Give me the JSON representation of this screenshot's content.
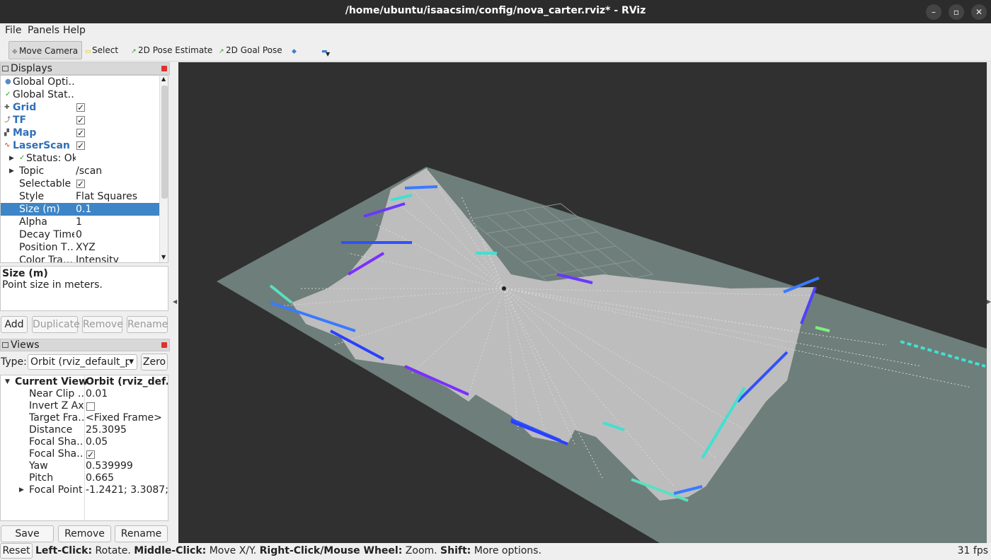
{
  "window": {
    "title": "/home/ubuntu/isaacsim/config/nova_carter.rviz* - RViz"
  },
  "menu": {
    "file": "File",
    "panels": "Panels",
    "help": "Help"
  },
  "toolbar": {
    "move_camera": "Move Camera",
    "select": "Select",
    "pose_estimate": "2D Pose Estimate",
    "goal_pose": "2D Goal Pose"
  },
  "displays": {
    "header": "Displays",
    "rows": [
      {
        "name": "Global Opti…",
        "value": ""
      },
      {
        "name": "Global Stat…",
        "value": ""
      },
      {
        "name": "Grid",
        "value": ""
      },
      {
        "name": "TF",
        "value": ""
      },
      {
        "name": "Map",
        "value": ""
      },
      {
        "name": "LaserScan",
        "value": ""
      },
      {
        "name": "Status: Ok",
        "value": ""
      },
      {
        "name": "Topic",
        "value": "/scan"
      },
      {
        "name": "Selectable",
        "value": ""
      },
      {
        "name": "Style",
        "value": "Flat Squares"
      },
      {
        "name": "Size (m)",
        "value": "0.1"
      },
      {
        "name": "Alpha",
        "value": "1"
      },
      {
        "name": "Decay Time",
        "value": "0"
      },
      {
        "name": "Position T…",
        "value": "XYZ"
      },
      {
        "name": "Color Tra…",
        "value": "Intensity"
      }
    ],
    "desc_title": "Size (m)",
    "desc_text": "Point size in meters.",
    "add": "Add",
    "duplicate": "Duplicate",
    "remove": "Remove",
    "rename": "Rename"
  },
  "views": {
    "header": "Views",
    "type_label": "Type:",
    "type_value": "Orbit (rviz_default_pl",
    "zero": "Zero",
    "current_view": "Current View",
    "current_view_value": "Orbit (rviz_def…",
    "rows": [
      {
        "name": "Near Clip …",
        "value": "0.01"
      },
      {
        "name": "Invert Z Axis",
        "value": ""
      },
      {
        "name": "Target Fra…",
        "value": "<Fixed Frame>"
      },
      {
        "name": "Distance",
        "value": "25.3095"
      },
      {
        "name": "Focal Sha…",
        "value": "0.05"
      },
      {
        "name": "Focal Sha…",
        "value": ""
      },
      {
        "name": "Yaw",
        "value": "0.539999"
      },
      {
        "name": "Pitch",
        "value": "0.665"
      },
      {
        "name": "Focal Point",
        "value": "-1.2421; 3.3087; …"
      }
    ],
    "save": "Save",
    "remove": "Remove",
    "rename": "Rename"
  },
  "status": {
    "reset": "Reset",
    "left_click": "Left-Click:",
    "left_click_text": "Rotate.",
    "middle_click": "Middle-Click:",
    "middle_click_text": "Move X/Y.",
    "right_click": "Right-Click/Mouse Wheel:",
    "right_click_text": "Zoom.",
    "shift": "Shift:",
    "shift_text": "More options.",
    "fps": "31 fps"
  },
  "colors": {
    "selection": "#3d85c6",
    "viewport_bg": "#303030",
    "map_plane": "#6e7e7a",
    "free_space": "#bdbdbd"
  }
}
